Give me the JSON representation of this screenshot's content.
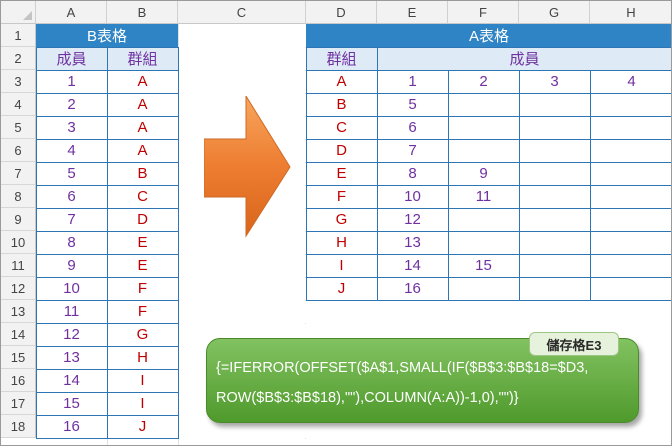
{
  "columns": [
    "A",
    "B",
    "C",
    "D",
    "E",
    "F",
    "G",
    "H"
  ],
  "rows": [
    "1",
    "2",
    "3",
    "4",
    "5",
    "6",
    "7",
    "8",
    "9",
    "10",
    "11",
    "12",
    "13",
    "14",
    "15",
    "16",
    "17",
    "18"
  ],
  "table_b": {
    "title": "B表格",
    "col1": "成員",
    "col2": "群組",
    "members": [
      "1",
      "2",
      "3",
      "4",
      "5",
      "6",
      "7",
      "8",
      "9",
      "10",
      "11",
      "12",
      "13",
      "14",
      "15",
      "16"
    ],
    "groups": [
      "A",
      "A",
      "A",
      "A",
      "B",
      "C",
      "D",
      "E",
      "E",
      "F",
      "F",
      "G",
      "H",
      "I",
      "I",
      "J"
    ]
  },
  "table_a": {
    "title": "A表格",
    "col_group": "群組",
    "col_members": "成員",
    "idx": [
      "1",
      "2",
      "3",
      "4"
    ],
    "groups": [
      "A",
      "B",
      "C",
      "D",
      "E",
      "F",
      "G",
      "H",
      "I",
      "J"
    ],
    "grid": [
      [
        "",
        "",
        "",
        ""
      ],
      [
        "5",
        "",
        "",
        ""
      ],
      [
        "6",
        "",
        "",
        ""
      ],
      [
        "7",
        "",
        "",
        ""
      ],
      [
        "8",
        "9",
        "",
        ""
      ],
      [
        "10",
        "11",
        "",
        ""
      ],
      [
        "12",
        "",
        "",
        ""
      ],
      [
        "13",
        "",
        "",
        ""
      ],
      [
        "14",
        "15",
        "",
        ""
      ],
      [
        "16",
        "",
        "",
        ""
      ]
    ]
  },
  "callout": {
    "label": "儲存格E3",
    "formula_line1": "{=IFERROR(OFFSET($A$1,SMALL(IF($B$3:$B$18=$D3,",
    "formula_line2": "ROW($B$3:$B$18),\"\"),COLUMN(A:A))-1,0),\"\")}"
  },
  "colors": {
    "header_blue": "#2f84c5",
    "header_light": "#deebf7",
    "text_purple": "#7030a0",
    "text_red": "#c00000",
    "arrow_orange": "#ed7d31",
    "callout_green": "#5aa832"
  },
  "icons": [
    "select-all-corner-icon",
    "right-arrow-icon"
  ]
}
